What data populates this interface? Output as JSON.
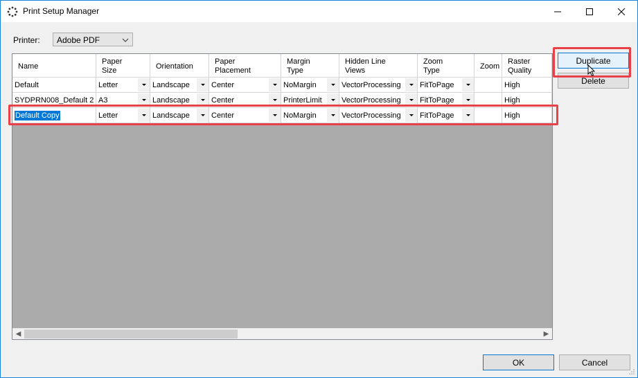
{
  "window": {
    "title": "Print Setup Manager"
  },
  "printer": {
    "label": "Printer:",
    "selected": "Adobe PDF"
  },
  "columns": [
    [
      "Name"
    ],
    [
      "Paper",
      "Size"
    ],
    [
      "Orientation"
    ],
    [
      "Paper",
      "Placement"
    ],
    [
      "Margin",
      "Type"
    ],
    [
      "Hidden Line",
      "Views"
    ],
    [
      "Zoom",
      "Type"
    ],
    [
      "Zoom"
    ],
    [
      "Raster",
      "Quality"
    ]
  ],
  "rows": [
    [
      "Default",
      "Letter",
      "Landscape",
      "Center",
      "NoMargin",
      "VectorProcessing",
      "FitToPage",
      "",
      "High"
    ],
    [
      "SYDPRN008_Default 2",
      "A3",
      "Landscape",
      "Center",
      "PrinterLimit",
      "VectorProcessing",
      "FitToPage",
      "",
      "High"
    ],
    [
      "Default Copy",
      "Letter",
      "Landscape",
      "Center",
      "NoMargin",
      "VectorProcessing",
      "FitToPage",
      "",
      "High"
    ]
  ],
  "buttons": {
    "duplicate": "Duplicate",
    "delete": "Delete",
    "ok": "OK",
    "cancel": "Cancel"
  },
  "colors": {
    "accent": "#0078d7",
    "callout": "#e8414a",
    "grid_background": "#ababab"
  },
  "icons": {
    "app": "spinner-dots-icon",
    "minimize": "minimize-icon",
    "maximize": "maximize-icon",
    "close": "close-icon"
  }
}
